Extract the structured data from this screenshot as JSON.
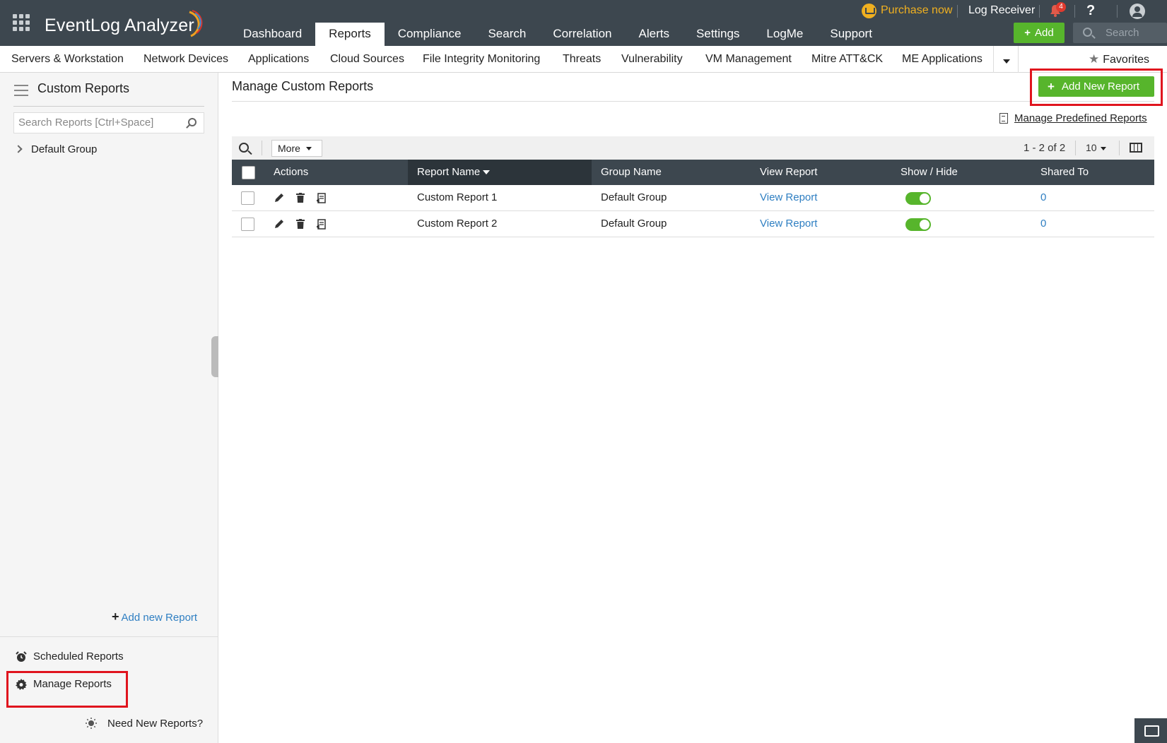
{
  "app": {
    "name": "EventLog Analyzer"
  },
  "top_nav": {
    "tabs": [
      {
        "label": "Dashboard"
      },
      {
        "label": "Reports",
        "active": true
      },
      {
        "label": "Compliance"
      },
      {
        "label": "Search"
      },
      {
        "label": "Correlation"
      },
      {
        "label": "Alerts"
      },
      {
        "label": "Settings"
      },
      {
        "label": "LogMe"
      },
      {
        "label": "Support"
      }
    ],
    "purchase_label": "Purchase now",
    "log_receiver_label": "Log Receiver",
    "notification_count": "4",
    "help_label": "?",
    "add_label": "Add",
    "search_placeholder": "Search"
  },
  "sub_nav": {
    "items": [
      {
        "label": "Servers & Workstation"
      },
      {
        "label": "Network Devices"
      },
      {
        "label": "Applications"
      },
      {
        "label": "Cloud Sources"
      },
      {
        "label": "File Integrity Monitoring"
      },
      {
        "label": "Threats"
      },
      {
        "label": "Vulnerability"
      },
      {
        "label": "VM Management"
      },
      {
        "label": "Mitre ATT&CK"
      },
      {
        "label": "ME Applications"
      }
    ],
    "favorites_label": "Favorites"
  },
  "sidebar": {
    "title": "Custom Reports",
    "search_placeholder": "Search Reports [Ctrl+Space]",
    "groups": [
      {
        "label": "Default Group"
      }
    ],
    "add_new_report_label": "Add new Report",
    "scheduled_reports_label": "Scheduled Reports",
    "manage_reports_label": "Manage Reports",
    "need_new_reports_label": "Need New Reports?"
  },
  "main": {
    "title": "Manage Custom Reports",
    "add_new_report_button": "Add New Report",
    "manage_predefined_label": "Manage Predefined Reports",
    "toolbar": {
      "more_label": "More",
      "pagination": "1 - 2 of 2",
      "per_page": "10"
    },
    "table": {
      "columns": [
        "Actions",
        "Report Name",
        "Group Name",
        "View Report",
        "Show / Hide",
        "Shared To"
      ],
      "rows": [
        {
          "report_name": "Custom Report 1",
          "group_name": "Default Group",
          "view_report": "View Report",
          "show": true,
          "shared_to": "0"
        },
        {
          "report_name": "Custom Report 2",
          "group_name": "Default Group",
          "view_report": "View Report",
          "show": true,
          "shared_to": "0"
        }
      ]
    }
  },
  "colors": {
    "topbar": "#3d474f",
    "accent_green": "#57b52c",
    "link_blue": "#2f7fc2",
    "highlight_red": "#e0141e",
    "purchase_gold": "#f0b020"
  }
}
